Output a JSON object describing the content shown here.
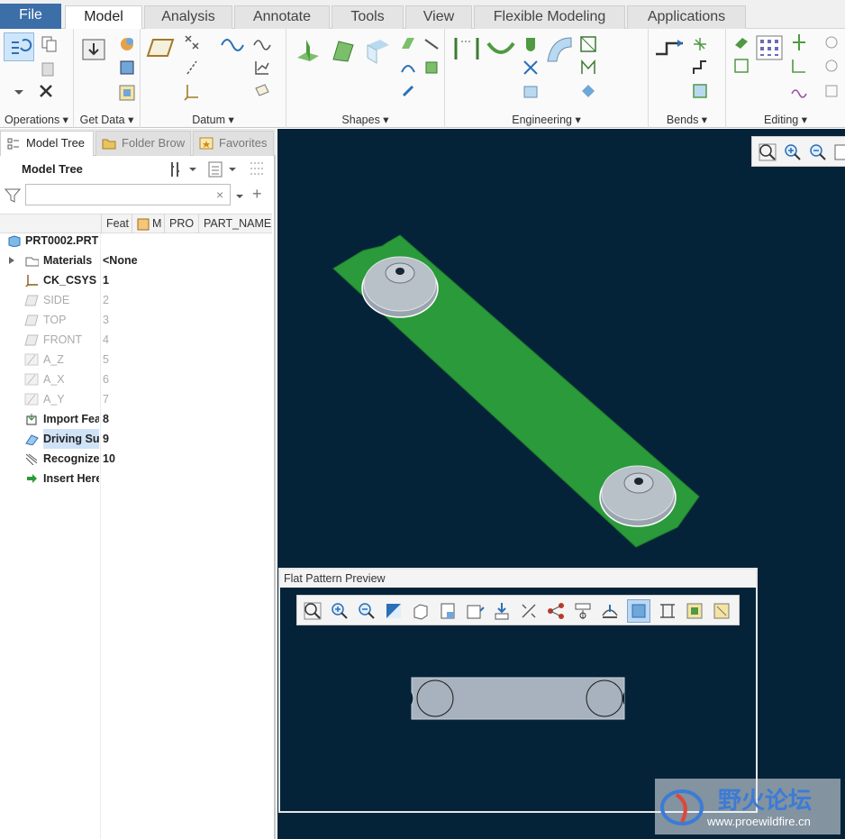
{
  "menubar": {
    "file": "File",
    "tabs": [
      "Model",
      "Analysis",
      "Annotate",
      "Tools",
      "View",
      "Flexible Modeling",
      "Applications"
    ],
    "active_tab": "Model"
  },
  "ribbon": {
    "groups": [
      "Operations",
      "Get Data",
      "Datum",
      "Shapes",
      "Engineering",
      "Bends",
      "Editing"
    ]
  },
  "panel": {
    "tabs": [
      "Model Tree",
      "Folder Brow",
      "Favorites"
    ],
    "tree_title": "Model Tree",
    "filter_placeholder": "",
    "columns": [
      "Feat",
      "M",
      "PRO",
      "PART_NAME"
    ],
    "rows": [
      {
        "name": "PRT0002.PRT",
        "num": "",
        "icon": "part-icon",
        "dim": false
      },
      {
        "name": "Materials",
        "num": "<None",
        "icon": "materials-icon",
        "dim": false
      },
      {
        "name": "CK_CSYS",
        "num": "1",
        "icon": "csys-icon",
        "dim": false
      },
      {
        "name": "SIDE",
        "num": "2",
        "icon": "datum-plane-icon",
        "dim": true
      },
      {
        "name": "TOP",
        "num": "3",
        "icon": "datum-plane-icon",
        "dim": true
      },
      {
        "name": "FRONT",
        "num": "4",
        "icon": "datum-plane-icon",
        "dim": true
      },
      {
        "name": "A_Z",
        "num": "5",
        "icon": "datum-axis-icon",
        "dim": true
      },
      {
        "name": "A_X",
        "num": "6",
        "icon": "datum-axis-icon",
        "dim": true
      },
      {
        "name": "A_Y",
        "num": "7",
        "icon": "datum-axis-icon",
        "dim": true
      },
      {
        "name": "Import Feat",
        "num": "8",
        "icon": "import-feature-icon",
        "dim": false
      },
      {
        "name": "Driving Sur",
        "num": "9",
        "icon": "driving-surface-icon",
        "dim": false
      },
      {
        "name": "Recognize",
        "num": "10",
        "icon": "recognize-icon",
        "dim": false
      },
      {
        "name": "Insert Here",
        "num": "",
        "icon": "insert-arrow-icon",
        "dim": false
      }
    ]
  },
  "flat_preview": {
    "title": "Flat Pattern Preview"
  },
  "watermark": {
    "cn": "野火论坛",
    "url": "www.proewildfire.cn"
  },
  "colors": {
    "viewport_bg": "#052338",
    "part_green": "#2a9a3a",
    "flat_gray": "#a8b2be",
    "file_tab": "#3c6ea8"
  }
}
